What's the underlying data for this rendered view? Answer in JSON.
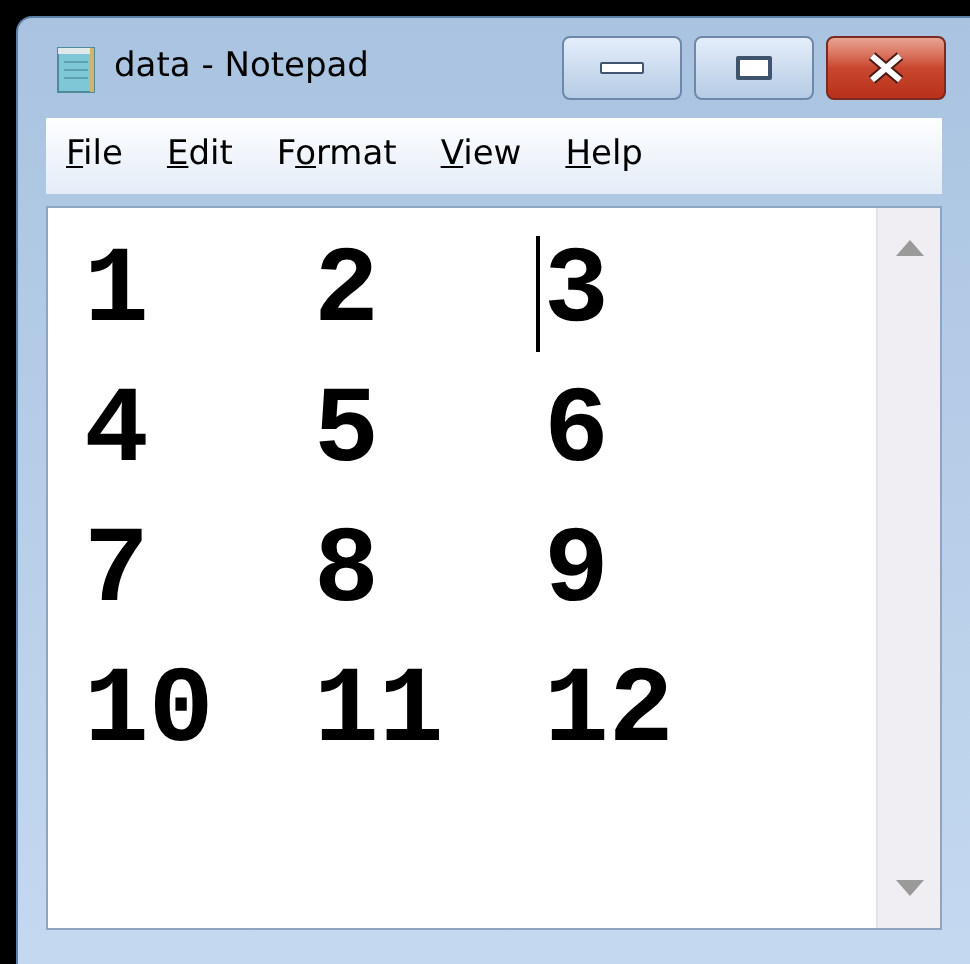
{
  "window": {
    "title": "data - Notepad"
  },
  "menu": [
    {
      "access_key": "F",
      "after": "ile"
    },
    {
      "access_key": "E",
      "after": "dit"
    },
    {
      "before": "F",
      "access_key": "o",
      "after": "rmat"
    },
    {
      "access_key": "V",
      "after": "iew"
    },
    {
      "access_key": "H",
      "after": "elp"
    }
  ],
  "editor": {
    "lines": [
      [
        {
          "text": "1",
          "caret_before": false
        },
        {
          "text": "2",
          "caret_before": false
        },
        {
          "text": "3",
          "caret_before": true
        }
      ],
      [
        {
          "text": "4",
          "caret_before": false
        },
        {
          "text": "5",
          "caret_before": false
        },
        {
          "text": "6",
          "caret_before": false
        }
      ],
      [
        {
          "text": "7",
          "caret_before": false
        },
        {
          "text": "8",
          "caret_before": false
        },
        {
          "text": "9",
          "caret_before": false
        }
      ],
      [
        {
          "text": "10",
          "caret_before": false
        },
        {
          "text": "11",
          "caret_before": false
        },
        {
          "text": "12",
          "caret_before": false
        }
      ]
    ]
  }
}
